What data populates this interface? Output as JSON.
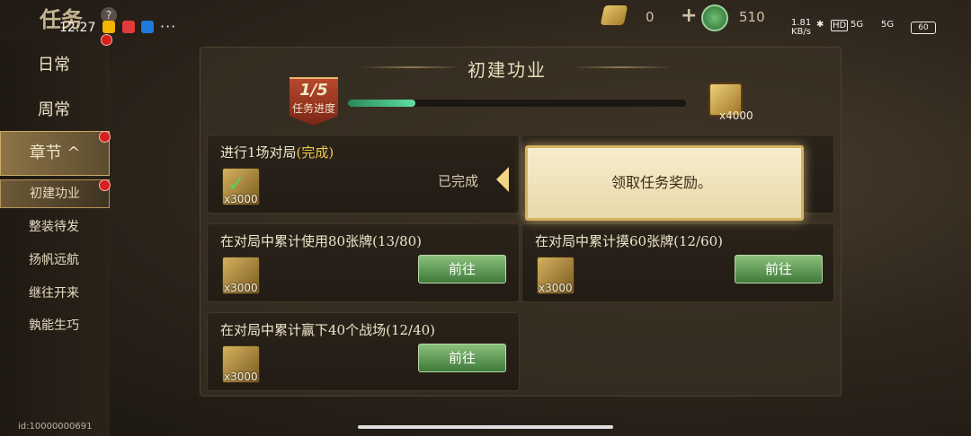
{
  "status_bar": {
    "time": "12:27",
    "more": "···",
    "network_speed": "1.81\nKB/s",
    "hd": "HD",
    "signal1": "5G",
    "signal2": "5G",
    "battery": "60"
  },
  "header": {
    "title": "任务",
    "help": "?"
  },
  "currency": {
    "scroll_amount": "0",
    "jade_amount": "510"
  },
  "sidebar": {
    "items": [
      {
        "label": "日常"
      },
      {
        "label": "周常"
      },
      {
        "label": "章节"
      }
    ],
    "chevron": "^",
    "sub_items": [
      {
        "label": "初建功业"
      },
      {
        "label": "整装待发"
      },
      {
        "label": "扬帆远航"
      },
      {
        "label": "继往开来"
      },
      {
        "label": "孰能生巧"
      }
    ]
  },
  "user_id": "id:10000000691",
  "panel": {
    "title": "初建功业"
  },
  "progress": {
    "count": "1/5",
    "label": "任务进度",
    "fraction": 0.2,
    "reward_qty": "x4000"
  },
  "tasks": [
    {
      "title": "进行1场对局",
      "status_suffix": "(完成)",
      "qty": "x3000",
      "done_label": "已完成"
    },
    {
      "title": "在对局中累计使用80张牌(13/80)",
      "qty": "x3000",
      "button": "前往"
    },
    {
      "title": "在对局中累计摸60张牌(12/60)",
      "qty": "x3000",
      "button": "前往"
    },
    {
      "title": "在对局中累计赢下40个战场(12/40)",
      "qty": "x3000",
      "button": "前往"
    }
  ],
  "tooltip": {
    "text": "领取任务奖励。"
  },
  "colors": {
    "accent_gold": "#d5b35e",
    "button_green": "#5e9a55",
    "badge_red": "#a63a22",
    "progress_green": "#5fe0a0"
  }
}
